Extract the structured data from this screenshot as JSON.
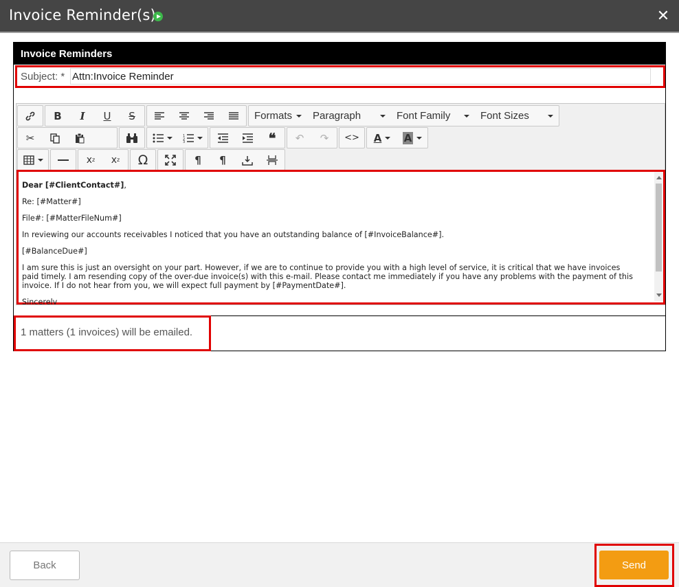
{
  "window": {
    "title": "Invoice Reminder(s)",
    "status_icon": "green-play-circle-icon",
    "close_icon": "close-icon"
  },
  "panel": {
    "header": "Invoice Reminders",
    "subject_label": "Subject: *",
    "subject_value": "Attn:Invoice Reminder"
  },
  "toolbar": {
    "formats": "Formats",
    "paragraph": "Paragraph",
    "font_family": "Font Family",
    "font_sizes": "Font Sizes"
  },
  "editor_body": {
    "greeting_bold": "Dear [#ClientContact#]",
    "greeting_comma": ",",
    "re_line": "Re: [#Matter#]",
    "file_line": "File#: [#MatterFileNum#]",
    "para1": "In reviewing our accounts receivables I noticed that you have an outstanding balance of [#InvoiceBalance#].",
    "balance_due": "[#BalanceDue#]",
    "para2_line1": "I am sure this is just an oversight on your part. However, if we are to continue to provide you with a high level of service, it is critical that we have invoices",
    "para2_line2": "paid timely. I am resending copy of the over-due invoice(s) with this e-mail. Please contact me immediately if you have any problems with the payment of this",
    "para2_line3": "invoice. If I do not hear from you, we will expect full payment by [#PaymentDate#].",
    "closing": "Sincerely"
  },
  "status": {
    "count_text": "1 matters (1 invoices) will be emailed."
  },
  "footer": {
    "back_label": "Back",
    "send_label": "Send"
  },
  "colors": {
    "titlebar": "#454545",
    "send": "#f39c12",
    "highlight": "#e00000"
  }
}
